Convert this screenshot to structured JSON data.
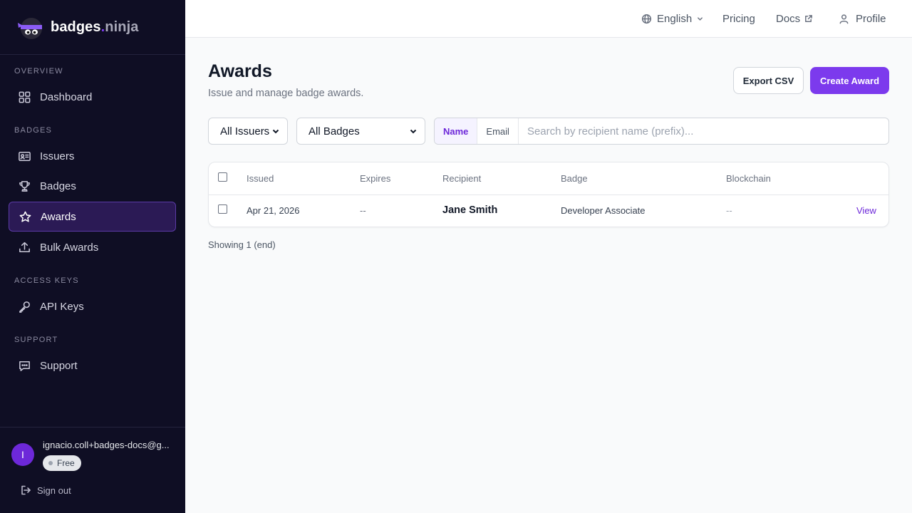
{
  "brand": {
    "name_main": "badges",
    "name_dot": ".",
    "name_suffix": "ninja"
  },
  "sidebar": {
    "sections": [
      {
        "title": "OVERVIEW",
        "items": [
          {
            "label": "Dashboard",
            "icon": "grid-icon"
          }
        ]
      },
      {
        "title": "BADGES",
        "items": [
          {
            "label": "Issuers",
            "icon": "id-card-icon"
          },
          {
            "label": "Badges",
            "icon": "trophy-icon"
          },
          {
            "label": "Awards",
            "icon": "star-icon",
            "active": true
          },
          {
            "label": "Bulk Awards",
            "icon": "upload-icon"
          }
        ]
      },
      {
        "title": "ACCESS KEYS",
        "items": [
          {
            "label": "API Keys",
            "icon": "key-icon"
          }
        ]
      },
      {
        "title": "SUPPORT",
        "items": [
          {
            "label": "Support",
            "icon": "chat-icon"
          }
        ]
      }
    ],
    "user": {
      "initial": "I",
      "email": "ignacio.coll+badges-docs@g...",
      "plan": "Free"
    },
    "signout_label": "Sign out"
  },
  "topbar": {
    "language": "English",
    "pricing": "Pricing",
    "docs": "Docs",
    "profile": "Profile"
  },
  "page": {
    "title": "Awards",
    "subtitle": "Issue and manage badge awards.",
    "export_label": "Export CSV",
    "create_label": "Create Award"
  },
  "filters": {
    "issuer_selected": "All Issuers",
    "badge_selected": "All Badges",
    "search_modes": [
      "Name",
      "Email"
    ],
    "search_mode_active": "Name",
    "search_placeholder": "Search by recipient name (prefix)..."
  },
  "table": {
    "columns": [
      "Issued",
      "Expires",
      "Recipient",
      "Badge",
      "Blockchain"
    ],
    "rows": [
      {
        "issued": "Apr 21, 2026",
        "expires": "--",
        "recipient": "Jane Smith",
        "badge": "Developer Associate",
        "blockchain": "--",
        "action": "View"
      }
    ],
    "footer": "Showing 1 (end)"
  },
  "colors": {
    "accent": "#7c3aed",
    "sidebar_bg": "#0f0e24",
    "page_bg": "#f9fafb"
  }
}
